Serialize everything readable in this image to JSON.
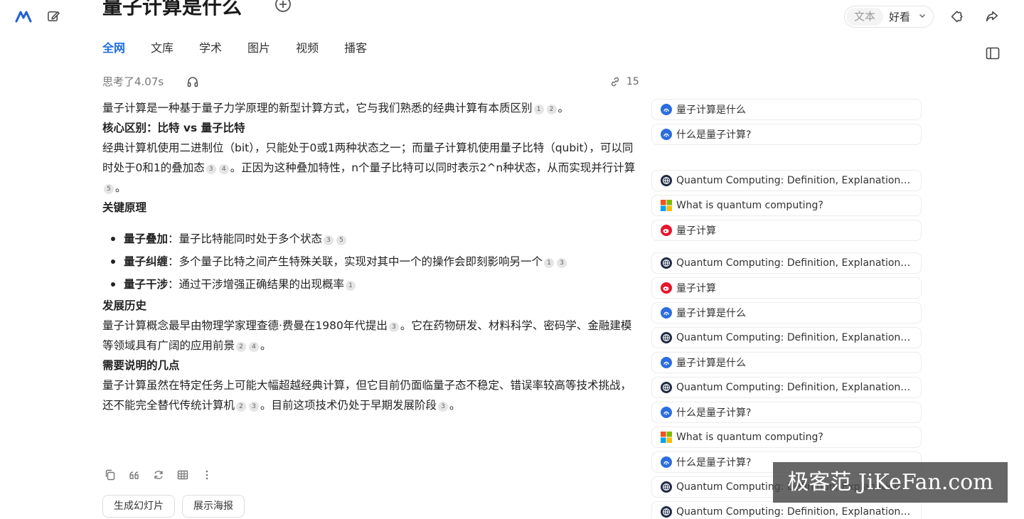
{
  "header": {
    "title": "量子计算是什么",
    "mode_text": "文本",
    "mode_selected": "好看"
  },
  "tabs": [
    "全网",
    "文库",
    "学术",
    "图片",
    "视频",
    "播客"
  ],
  "meta": {
    "thought": "思考了4.07s",
    "link_count": "15"
  },
  "answer": {
    "intro": "量子计算是一种基于量子力学原理的新型计算方式，它与我们熟悉的经典计算有本质区别",
    "s1_heading": "核心区别：比特 vs 量子比特",
    "s1_text_a": "经典计算机使用二进制位（bit），只能处于0或1两种状态之一；而量子计算机使用量子比特（qubit），可以同时处于0和1的叠加态",
    "s1_text_b": "。正因为这种叠加特性，n个量子比特可以同时表示2^n种状态，从而实现并行计算",
    "s2_heading": "关键原理",
    "bullets": [
      {
        "label": "量子叠加",
        "text": "：量子比特能同时处于多个状态"
      },
      {
        "label": "量子纠缠",
        "text": "：多个量子比特之间产生特殊关联，实现对其中一个的操作会即刻影响另一个"
      },
      {
        "label": "量子干涉",
        "text": "：通过干涉增强正确结果的出现概率"
      }
    ],
    "s3_heading": "发展历史",
    "s3_text_a": "量子计算概念最早由物理学家理查德·费曼在1980年代提出",
    "s3_text_b": "。它在药物研发、材料科学、密码学、金融建模等领域具有广阔的应用前景",
    "s4_heading": "需要说明的几点",
    "s4_text_a": "量子计算虽然在特定任务上可能大幅超越经典计算，但它目前仍面临量子态不稳定、错误率较高等技术挑战，还不能完全替代传统计算机",
    "s4_text_b": "。目前这项技术仍处于早期发展阶段",
    "period": "。"
  },
  "buttons": {
    "slides": "生成幻灯片",
    "poster": "展示海报"
  },
  "sources": [
    {
      "title": "量子计算是什么",
      "icon": "baidu-icon"
    },
    {
      "title": "什么是量子计算?",
      "icon": "baidu-icon"
    },
    {
      "title": "Quantum Computing: Definition, Explanation, and Examples",
      "icon": "globe-icon"
    },
    {
      "title": "What is quantum computing?",
      "icon": "microsoft-icon"
    },
    {
      "title": "量子计算",
      "icon": "weibo-icon"
    },
    {
      "title": "Quantum Computing: Definition, Explanation, and Examples",
      "icon": "globe-icon"
    },
    {
      "title": "量子计算",
      "icon": "weibo-icon"
    },
    {
      "title": "量子计算是什么",
      "icon": "baidu-icon"
    },
    {
      "title": "Quantum Computing: Definition, Explanation, and Examples",
      "icon": "globe-icon"
    },
    {
      "title": "量子计算是什么",
      "icon": "baidu-icon"
    },
    {
      "title": "Quantum Computing: Definition, Explanation, and Examples",
      "icon": "globe-icon"
    },
    {
      "title": "什么是量子计算?",
      "icon": "baidu-icon"
    },
    {
      "title": "What is quantum computing?",
      "icon": "microsoft-icon"
    },
    {
      "title": "什么是量子计算?",
      "icon": "baidu-icon"
    },
    {
      "title": "Quantum Computing: Definition, Explanation, and Examples",
      "icon": "globe-icon"
    },
    {
      "title": "Quantum Computing: Definition, Explanation, and Examples",
      "icon": "globe-icon"
    }
  ],
  "watermark": "极客范 JiKeFan.com",
  "colors": {
    "accent": "#1f6fe0",
    "baidu": "#2b6de0",
    "weibo": "#e6162d"
  }
}
